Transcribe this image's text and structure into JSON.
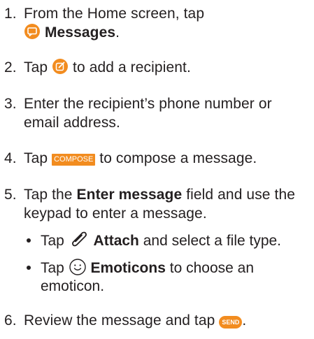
{
  "steps": [
    {
      "number": "1.",
      "text_a": "From the Home screen, tap",
      "icon": "messages-icon",
      "bold": "Messages",
      "text_b": "."
    },
    {
      "number": "2.",
      "text_a": "Tap",
      "icon": "compose-icon",
      "text_b": "to add a recipient."
    },
    {
      "number": "3.",
      "line1": "Enter the recipient’s phone number or",
      "line2": "email address."
    },
    {
      "number": "4.",
      "text_a": "Tap",
      "button": "COMPOSE",
      "text_b": "to compose a message."
    },
    {
      "number": "5.",
      "text_a": "Tap the",
      "bold": "Enter message",
      "text_b": "field and use the",
      "line2": "keypad to enter a message.",
      "bullets": [
        {
          "icon": "paperclip-icon",
          "text_a": "Tap",
          "bold": "Attach",
          "text_b": "and select a file type."
        },
        {
          "icon": "smiley-icon",
          "text_a": "Tap",
          "bold": "Emoticons",
          "text_b": "to choose an",
          "line2": "emoticon."
        }
      ]
    },
    {
      "number": "6.",
      "text_a": "Review the message and tap",
      "button": "SEND",
      "text_b": "."
    }
  ],
  "colors": {
    "accent": "#f28c1f",
    "text": "#231f20",
    "background": "#ffffff"
  }
}
